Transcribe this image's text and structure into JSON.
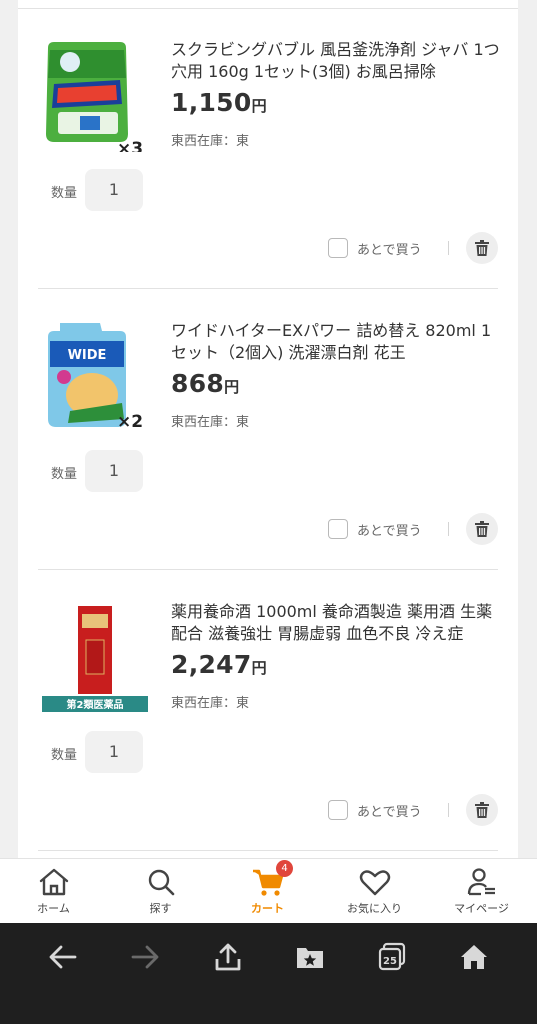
{
  "cart": {
    "items": [
      {
        "title": "スクラビングバブル 風呂釜洗浄剤 ジャバ 1つ穴用 160g 1セット(3個) お風呂掃除",
        "price": "1,150",
        "currency": "円",
        "stock": "東西在庫：東",
        "quantity_label": "数量",
        "quantity": "1",
        "pack_count": "×3",
        "later_label": "あとで買う",
        "image_icon": "java-bath-cleaner-package"
      },
      {
        "title": "ワイドハイターEXパワー 詰め替え 820ml 1セット（2個入) 洗濯漂白剤 花王",
        "price": "868",
        "currency": "円",
        "stock": "東西在庫：東",
        "quantity_label": "数量",
        "quantity": "1",
        "pack_count": "×2",
        "later_label": "あとで買う",
        "image_icon": "wide-haiter-refill-package"
      },
      {
        "title": "薬用養命酒 1000ml 養命酒製造 薬用酒 生薬配合 滋養強壮 胃腸虚弱 血色不良 冷え症",
        "price": "2,247",
        "currency": "円",
        "stock": "東西在庫：東",
        "quantity_label": "数量",
        "quantity": "1",
        "drug_class_label": "第2類医薬品",
        "later_label": "あとで買う",
        "image_icon": "yomeishu-box"
      }
    ]
  },
  "tabbar": {
    "tabs": [
      {
        "label": "ホーム",
        "icon": "home-icon"
      },
      {
        "label": "探す",
        "icon": "search-icon"
      },
      {
        "label": "カート",
        "icon": "cart-icon",
        "badge": "4",
        "active": true
      },
      {
        "label": "お気に入り",
        "icon": "heart-icon"
      },
      {
        "label": "マイページ",
        "icon": "user-icon"
      }
    ]
  },
  "browser": {
    "tab_count": "25",
    "buttons": [
      "back-icon",
      "forward-icon",
      "share-icon",
      "bookmarks-icon",
      "tabs-icon",
      "home-icon"
    ]
  },
  "colors": {
    "accent": "#f08a00",
    "badge": "#e0463c",
    "browser_bar": "#1f1f1f"
  }
}
